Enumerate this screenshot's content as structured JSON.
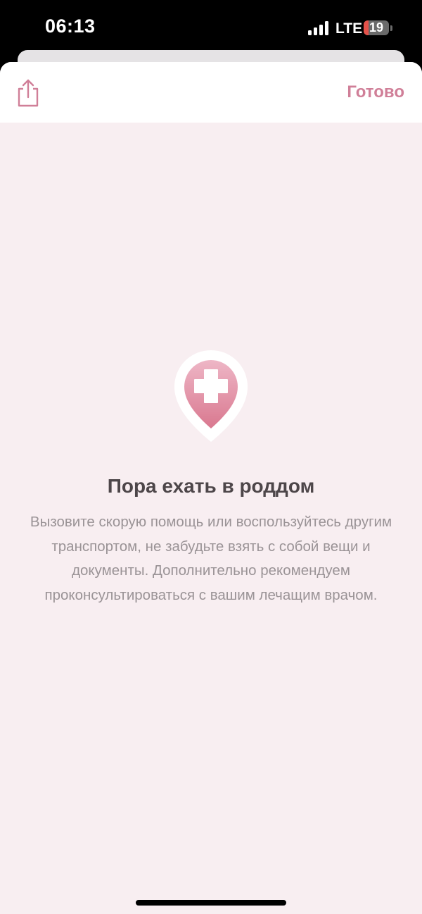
{
  "status_bar": {
    "time": "06:13",
    "network": "LTE",
    "battery_level": "19"
  },
  "header": {
    "share_icon": "share-icon",
    "done_label": "Готово"
  },
  "content": {
    "icon": "hospital-location-pin-icon",
    "title": "Пора ехать в роддом",
    "description": "Вызовите скорую помощь или воспользуйтесь другим транспортом, не забудьте взять с собой вещи и документы. Дополнительно рекомендуем проконсультироваться с вашим лечащим врачом."
  },
  "colors": {
    "accent": "#d07f98",
    "background": "#f8eef1",
    "title": "#4d4649",
    "text": "#9a9396"
  }
}
